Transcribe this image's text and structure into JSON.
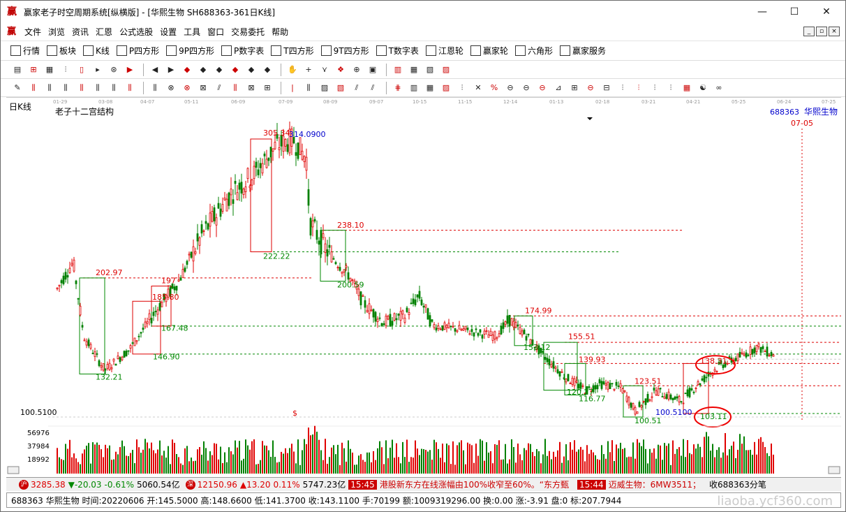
{
  "window": {
    "title": "赢家老子时空周期系统[纵横版] - [华熙生物  SH688363-361日K线]",
    "app_icon_text": "赢",
    "controls": [
      "—",
      "☐",
      "✕"
    ]
  },
  "menubar": {
    "logo": "赢",
    "items": [
      "文件",
      "浏览",
      "资讯",
      "汇恩",
      "公式选股",
      "设置",
      "工具",
      "窗口",
      "交易委托",
      "帮助"
    ],
    "mdi_controls": [
      "_",
      "▫",
      "×"
    ]
  },
  "toolbar1": {
    "items": [
      {
        "label": "行情",
        "icon": "table-icon"
      },
      {
        "label": "板块",
        "icon": "blocks-icon"
      },
      {
        "label": "K线",
        "icon": "kline-icon"
      },
      {
        "label": "P四方形",
        "icon": "p-square-icon"
      },
      {
        "label": "9P四方形",
        "icon": "9p-square-icon"
      },
      {
        "label": "P数字表",
        "icon": "p-table-icon"
      },
      {
        "label": "T四方形",
        "icon": "t-square-icon"
      },
      {
        "label": "9T四方形",
        "icon": "9t-square-icon"
      },
      {
        "label": "T数字表",
        "icon": "t-table-icon"
      },
      {
        "label": "江恩轮",
        "icon": "gann-wheel-icon"
      },
      {
        "label": "赢家轮",
        "icon": "winner-wheel-icon"
      },
      {
        "label": "六角形",
        "icon": "hexagon-icon"
      },
      {
        "label": "赢家服务",
        "icon": "dollar-icon"
      }
    ]
  },
  "chart": {
    "panel_label": "日K线",
    "indicator_name": "老子十二宫结构",
    "stock_code": "688363",
    "stock_name": "华熙生物",
    "date_axis": [
      "01-29",
      "03-08",
      "04-07",
      "05-11",
      "06-09",
      "07-09",
      "08-09",
      "09-07",
      "10-15",
      "11-15",
      "12-14",
      "01-13",
      "02-18",
      "03-21",
      "04-21",
      "05-25",
      "06-24",
      "07-25"
    ],
    "marker_date": "07-05",
    "price_labels": {
      "high_left": "305.34",
      "high_top": "314.0900",
      "l238": "238.10",
      "l222": "222.22",
      "l202": "202.97",
      "l200": "200.59",
      "l197": "197",
      "l185": "185.80",
      "l175": "174.99",
      "l167": "167.48",
      "l155": "155.51",
      "l153": "153.12",
      "l147": "146.90",
      "l140": "139.93",
      "l138": "138.31",
      "l132": "132.21",
      "l124": "123.51",
      "l120": "120.27",
      "l117": "116.77",
      "l103": "103.11",
      "l100a": "100.5100",
      "l100b": "100.51",
      "l100c": "100.5100"
    },
    "volume_labels": [
      "56976",
      "37984",
      "18992"
    ],
    "dollar_mark": "$"
  },
  "statusbar": {
    "index1_value": "3285.38",
    "index1_change": "▼-20.03",
    "index1_pct": "-0.61%",
    "index1_amount": "5060.54亿",
    "index2_value": "12150.96",
    "index2_change": "▲13.20",
    "index2_pct": "0.11%",
    "index2_amount": "5747.23亿",
    "news_time1": "15:45",
    "news1": "港股新东方在线涨幅由100%收窄至60%。“东方甄",
    "news_time2": "15:44",
    "news2": "迈威生物：6MW3511；",
    "tail": "收688363分笔"
  },
  "infobar": {
    "text": "688363 华熙生物 时间:20220606 开:145.5000 高:148.6600 低:141.3700 收:143.1100 手:70199 额:1009319296.00 换:0.00 涨:-3.91 盘:0 标:207.7944"
  },
  "watermark": "liaoba.ycf360.com",
  "colors": {
    "up": "#e00000",
    "down": "#008000",
    "box_red": "#d00000",
    "box_green": "#008000",
    "label_blue": "#0000cc"
  }
}
